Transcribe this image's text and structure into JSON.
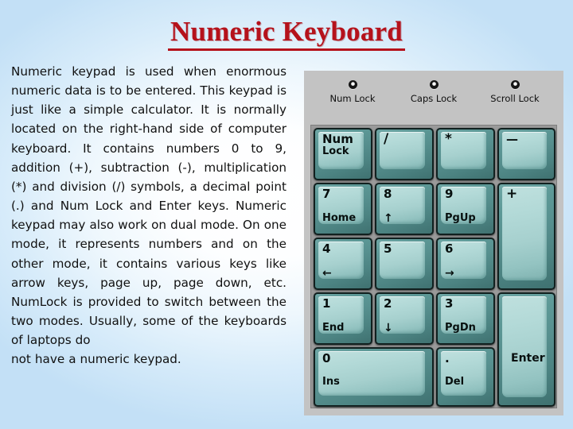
{
  "slide": {
    "title": "Numeric Keyboard",
    "title_color": "#b5121b",
    "background_accent": "#cfe6f8"
  },
  "body": {
    "paragraph": "Numeric keypad is used when enormous numeric data is to be entered. This keypad is just like a simple calculator. It is normally located on the right-hand side of computer keyboard. It contains numbers 0 to 9, addition (+), subtraction (-), multiplication (*) and division (/) symbols, a decimal point (.) and Num Lock and Enter keys. Numeric keypad may also work on dual mode. On one mode, it represents numbers and on the other mode, it contains various keys like arrow keys, page up, page down, etc. NumLock is provided to switch between the two modes. Usually, some of the keyboards of laptops do",
    "last_line": "not have a numeric keypad."
  },
  "keypad": {
    "panel_color": "#c3c3c3",
    "key_face_color": "#a6d0ce",
    "key_side_color": "#4c8382",
    "indicators": [
      {
        "label": "Num Lock",
        "icon": "led-indicator-icon"
      },
      {
        "label": "Caps Lock",
        "icon": "led-indicator-icon"
      },
      {
        "label": "Scroll Lock",
        "icon": "led-indicator-icon"
      }
    ],
    "keys": [
      {
        "name": "key-num-lock",
        "top": "Num",
        "bottom": "Lock",
        "style": "two-line"
      },
      {
        "name": "key-divide",
        "symbol": "/",
        "style": "symbol"
      },
      {
        "name": "key-multiply",
        "symbol": "*",
        "style": "symbol"
      },
      {
        "name": "key-minus",
        "symbol": "—",
        "style": "symbol"
      },
      {
        "name": "key-7-home",
        "top": "7",
        "bottom": "Home",
        "style": "two-line"
      },
      {
        "name": "key-8-up",
        "top": "8",
        "bottom": "↑",
        "style": "two-line-arrow"
      },
      {
        "name": "key-9-pgup",
        "top": "9",
        "bottom": "PgUp",
        "style": "two-line"
      },
      {
        "name": "key-plus",
        "symbol": "+",
        "style": "symbol-tall"
      },
      {
        "name": "key-4-left",
        "top": "4",
        "bottom": "←",
        "style": "two-line-arrow"
      },
      {
        "name": "key-5",
        "top": "5",
        "bottom": "",
        "style": "two-line"
      },
      {
        "name": "key-6-right",
        "top": "6",
        "bottom": "→",
        "style": "two-line-arrow"
      },
      {
        "name": "key-1-end",
        "top": "1",
        "bottom": "End",
        "style": "two-line"
      },
      {
        "name": "key-2-down",
        "top": "2",
        "bottom": "↓",
        "style": "two-line-arrow"
      },
      {
        "name": "key-3-pgdn",
        "top": "3",
        "bottom": "PgDn",
        "style": "two-line"
      },
      {
        "name": "key-enter",
        "symbol": "Enter",
        "style": "enter-tall"
      },
      {
        "name": "key-0-ins",
        "top": "0",
        "bottom": "Ins",
        "style": "two-line-wide"
      },
      {
        "name": "key-period-del",
        "top": ".",
        "bottom": "Del",
        "style": "two-line"
      }
    ]
  }
}
